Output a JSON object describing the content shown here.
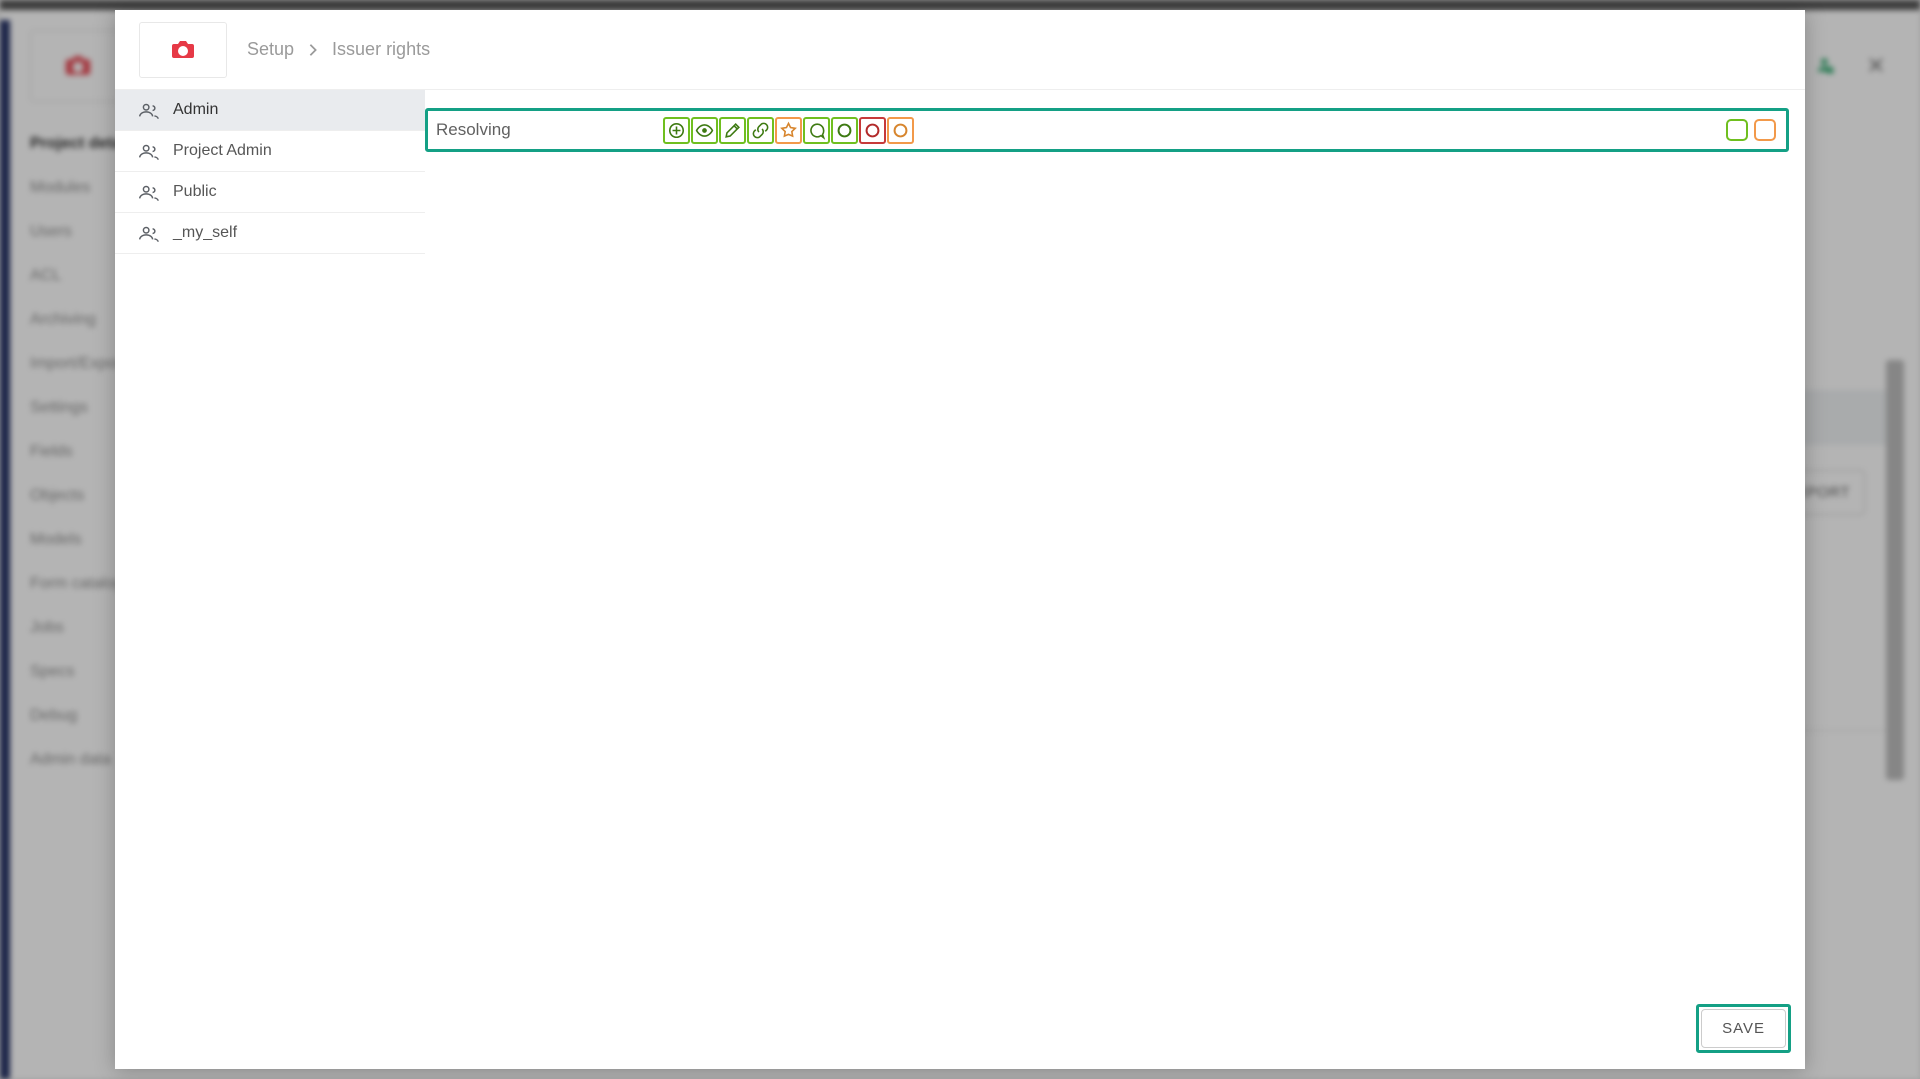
{
  "backdrop": {
    "sidebar_items": [
      "Project details",
      "Modules",
      "Users",
      "ACL",
      "Archiving",
      "Import/Export",
      "Settings",
      "Fields",
      "Objects",
      "Models",
      "Form catalog",
      "Jobs",
      "Specs",
      "Debug",
      "Admin data"
    ],
    "active_index": 0,
    "export_label": "EXPORT"
  },
  "modal": {
    "breadcrumb": {
      "root": "Setup",
      "leaf": "Issuer rights"
    },
    "groups": [
      {
        "name": "Admin",
        "active": true
      },
      {
        "name": "Project Admin",
        "active": false
      },
      {
        "name": "Public",
        "active": false
      },
      {
        "name": "_my_self",
        "active": false
      }
    ],
    "row": {
      "label": "Resolving",
      "perms": [
        {
          "id": "create",
          "color": "green",
          "icon": "plus"
        },
        {
          "id": "view",
          "color": "green",
          "icon": "eye"
        },
        {
          "id": "edit",
          "color": "green",
          "icon": "pencil"
        },
        {
          "id": "link",
          "color": "green",
          "icon": "link"
        },
        {
          "id": "star",
          "color": "orange",
          "icon": "star"
        },
        {
          "id": "comment",
          "color": "green",
          "icon": "chat"
        },
        {
          "id": "status-a",
          "color": "green",
          "icon": "circle"
        },
        {
          "id": "status-b",
          "color": "red",
          "icon": "circle"
        },
        {
          "id": "status-c",
          "color": "orange",
          "icon": "circle"
        }
      ],
      "trailing": [
        {
          "color": "green"
        },
        {
          "color": "orange"
        }
      ]
    },
    "save_label": "SAVE"
  }
}
